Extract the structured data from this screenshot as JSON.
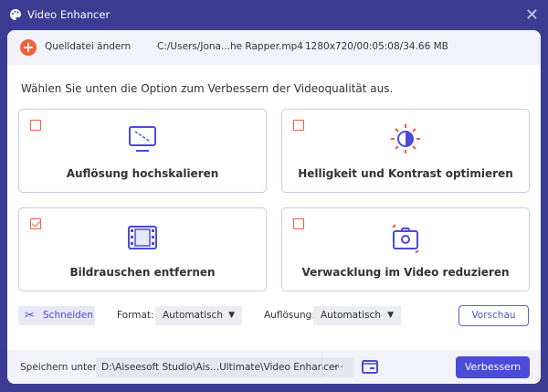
{
  "window": {
    "title": "Video Enhancer"
  },
  "source": {
    "change_label": "Quelldatei ändern",
    "file": "C:/Users/Jona...he Rapper.mp4",
    "info": "1280x720/00:05:08/34.66 MB"
  },
  "hint": "Wählen Sie unten die Option zum Verbessern der Videoqualität aus.",
  "options": [
    {
      "label": "Auflösung hochskalieren",
      "checked": false,
      "icon": "monitor-upscale-icon"
    },
    {
      "label": "Helligkeit und Kontrast optimieren",
      "checked": false,
      "icon": "brightness-icon"
    },
    {
      "label": "Bildrauschen entfernen",
      "checked": true,
      "icon": "film-icon"
    },
    {
      "label": "Verwacklung im Video reduzieren",
      "checked": false,
      "icon": "camera-shake-icon"
    }
  ],
  "controls": {
    "cut_label": "Schneiden",
    "format_label": "Format:",
    "format_value": "Automatisch",
    "resolution_label": "Auflösung:",
    "resolution_value": "Automatisch",
    "preview_label": "Vorschau"
  },
  "footer": {
    "save_label": "Speichern unter:",
    "path": "D:\\Aiseesoft Studio\\Ais...Ultimate\\Video Enhancer",
    "browse": "···",
    "enhance_label": "Verbessern"
  },
  "colors": {
    "accent": "#4b4bd8",
    "window": "#3d3c93",
    "checkbox": "#f0603c"
  }
}
